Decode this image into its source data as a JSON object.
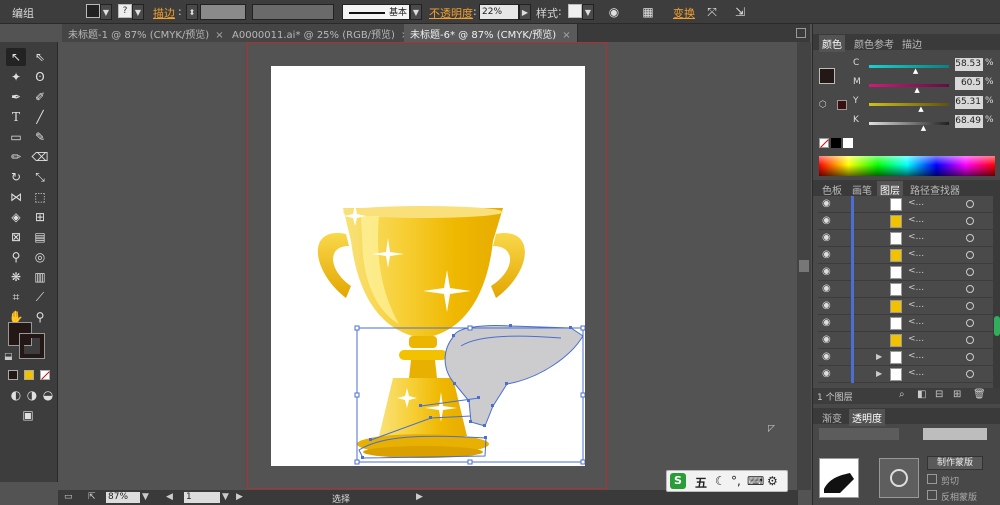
{
  "control_bar": {
    "mode_label": "编组",
    "stroke_label": "描边",
    "stroke_colon": ":",
    "brush_label": "基本",
    "opacity_label": "不透明度",
    "opacity_colon": ":",
    "opacity_value": "22%",
    "style_label": "样式",
    "style_colon": ":",
    "transform_label": "变换"
  },
  "tabs": [
    {
      "label": "未标题-1 @ 87% (CMYK/预览)",
      "close": "×"
    },
    {
      "label": "A0000011.ai* @ 25% (RGB/预览)",
      "close": "×"
    },
    {
      "label": "未标题-6* @ 87% (CMYK/预览)",
      "close": "×"
    }
  ],
  "status_bar": {
    "zoom": "87%",
    "page": "1",
    "tool_name": "选择"
  },
  "color_panel": {
    "tabs": [
      "颜色",
      "颜色参考",
      "描边"
    ],
    "channels": [
      {
        "name": "C",
        "value": "58.53",
        "pct": "%",
        "fraction": 0.5853,
        "colors": [
          "#1bd0d0",
          "#0a8080"
        ]
      },
      {
        "name": "M",
        "value": "60.5",
        "pct": "%",
        "fraction": 0.605,
        "colors": [
          "#d01b7a",
          "#601040"
        ]
      },
      {
        "name": "Y",
        "value": "65.31",
        "pct": "%",
        "fraction": 0.6531,
        "colors": [
          "#d0c01b",
          "#605010"
        ]
      },
      {
        "name": "K",
        "value": "68.49",
        "pct": "%",
        "fraction": 0.6849,
        "colors": [
          "#e0e0e0",
          "#202020"
        ]
      }
    ]
  },
  "layers_panel": {
    "tabs": [
      "色板",
      "画笔",
      "图层",
      "路径查找器"
    ],
    "row_name": "<...",
    "footer": "1 个图层"
  },
  "lower_panel": {
    "tab": "渐变",
    "tab2": "透明度",
    "make_mask": "制作蒙版",
    "clip": "剪切",
    "invert": "反相蒙版"
  },
  "ime": {
    "logo": "S",
    "mode": "五"
  },
  "colors": {
    "gold": "#f2c200",
    "gold_light": "#fff3a0",
    "selection_blue": "#4a6fd0",
    "artboard_red": "#b03030"
  }
}
